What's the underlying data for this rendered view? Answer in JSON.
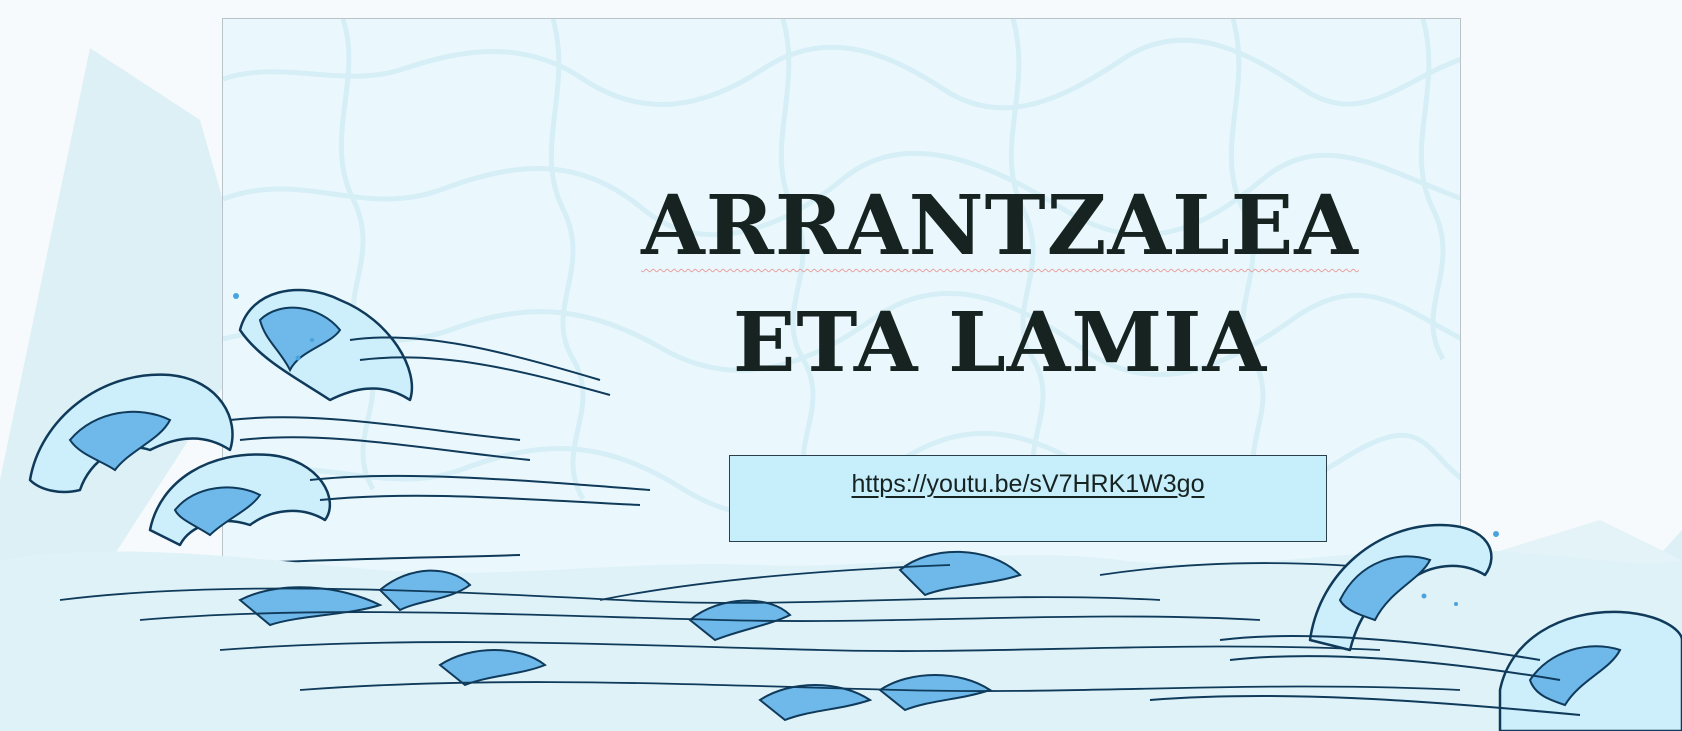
{
  "slide": {
    "title_line_1": "ARRANTZALEA",
    "title_line_2": "ETA LAMIA",
    "link_text": "https://youtu.be/sV7HRK1W3go"
  },
  "colors": {
    "canvas": "#f7fafc",
    "slide_background": "#eaf8fd",
    "title_text": "#172321",
    "link_box_fill": "#c6eefb",
    "wave_light": "#cdeefb",
    "wave_mid": "#6fb8ea",
    "wave_dark": "#0f3a5a",
    "mountain": "#dcf0f6"
  },
  "icons": {
    "decoration": "ocean-waves-illustration",
    "background_pattern": "cracked-stone-pattern"
  }
}
